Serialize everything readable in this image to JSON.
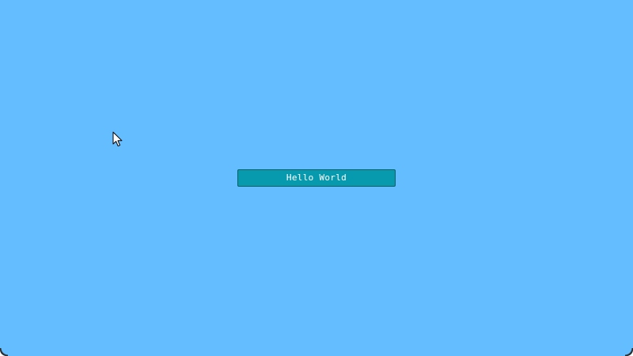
{
  "window": {
    "background_color": "#64bdff"
  },
  "main": {
    "button_label": "Hello World",
    "button_color": "#079aae"
  },
  "cursor": {
    "icon": "arrow-pointer-icon"
  }
}
